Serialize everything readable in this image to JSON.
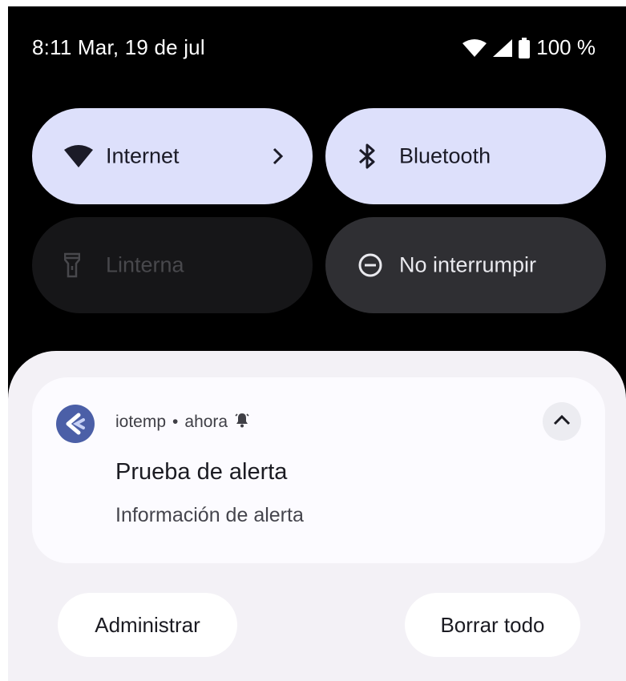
{
  "status": {
    "time": "8:11",
    "date": "Mar, 19 de jul",
    "battery": "100 %",
    "icons": [
      "wifi-icon",
      "signal-icon",
      "battery-icon"
    ]
  },
  "tiles": [
    {
      "label": "Internet",
      "icon": "wifi-icon",
      "state": "on",
      "has_chevron": true
    },
    {
      "label": "Bluetooth",
      "icon": "bluetooth-icon",
      "state": "on"
    },
    {
      "label": "Linterna",
      "icon": "flashlight-icon",
      "state": "unavailable"
    },
    {
      "label": "No interrumpir",
      "icon": "do-not-disturb-icon",
      "state": "off"
    }
  ],
  "notification": {
    "app": "iotemp",
    "separator": "•",
    "time": "ahora",
    "title": "Prueba de alerta",
    "body": "Información de alerta"
  },
  "actions": {
    "manage": "Administrar",
    "clear_all": "Borrar todo"
  },
  "colors": {
    "tile_on": "#dde0fb",
    "tile_off": "#2f2f33",
    "sheet": "#f3f1f6",
    "app_icon": "#4b5fa7"
  }
}
